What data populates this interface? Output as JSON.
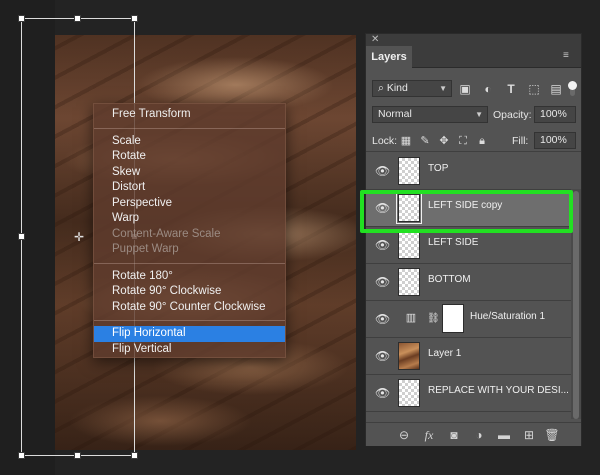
{
  "context_menu": {
    "groups": [
      [
        {
          "label": "Free Transform",
          "state": "enabled"
        }
      ],
      [
        {
          "label": "Scale",
          "state": "enabled"
        },
        {
          "label": "Rotate",
          "state": "enabled"
        },
        {
          "label": "Skew",
          "state": "enabled"
        },
        {
          "label": "Distort",
          "state": "enabled"
        },
        {
          "label": "Perspective",
          "state": "enabled"
        },
        {
          "label": "Warp",
          "state": "enabled"
        },
        {
          "label": "Content-Aware Scale",
          "state": "disabled"
        },
        {
          "label": "Puppet Warp",
          "state": "disabled"
        }
      ],
      [
        {
          "label": "Rotate 180°",
          "state": "enabled"
        },
        {
          "label": "Rotate 90° Clockwise",
          "state": "enabled"
        },
        {
          "label": "Rotate 90° Counter Clockwise",
          "state": "enabled"
        }
      ],
      [
        {
          "label": "Flip Horizontal",
          "state": "highlighted"
        },
        {
          "label": "Flip Vertical",
          "state": "enabled"
        }
      ]
    ]
  },
  "layers_panel": {
    "close_glyph": "✕",
    "tab_label": "Layers",
    "menu_glyph": "≡",
    "filter": {
      "search_glyph": "⌕",
      "kind_label": "Kind",
      "icons": [
        "image-filter-icon",
        "adjustment-filter-icon",
        "type-filter-icon",
        "shape-filter-icon",
        "smart-object-filter-icon"
      ]
    },
    "blend_mode": "Normal",
    "opacity_label": "Opacity:",
    "opacity_value": "100%",
    "lock_label": "Lock:",
    "fill_label": "Fill:",
    "fill_value": "100%",
    "layers": [
      {
        "name": "TOP",
        "type": "transparent",
        "selected": false
      },
      {
        "name": "LEFT SIDE copy",
        "type": "transparent",
        "selected": true
      },
      {
        "name": "LEFT SIDE",
        "type": "transparent",
        "selected": false
      },
      {
        "name": "BOTTOM",
        "type": "transparent",
        "selected": false
      },
      {
        "name": "Hue/Saturation 1",
        "type": "adjustment",
        "selected": false
      },
      {
        "name": "Layer 1",
        "type": "image",
        "selected": false
      },
      {
        "name": "REPLACE WITH YOUR DESI...",
        "type": "transparent",
        "selected": false
      }
    ],
    "bottom_icons": [
      "link-layers-icon",
      "fx-icon",
      "add-mask-icon",
      "new-adjustment-icon",
      "new-group-icon",
      "new-layer-icon",
      "delete-layer-icon"
    ],
    "fx_label": "fx"
  },
  "colors": {
    "menu_highlight": "#2b80e3",
    "callout_green": "#22e022",
    "panel_bg": "#535353",
    "selected_row": "#6e6e6e"
  }
}
